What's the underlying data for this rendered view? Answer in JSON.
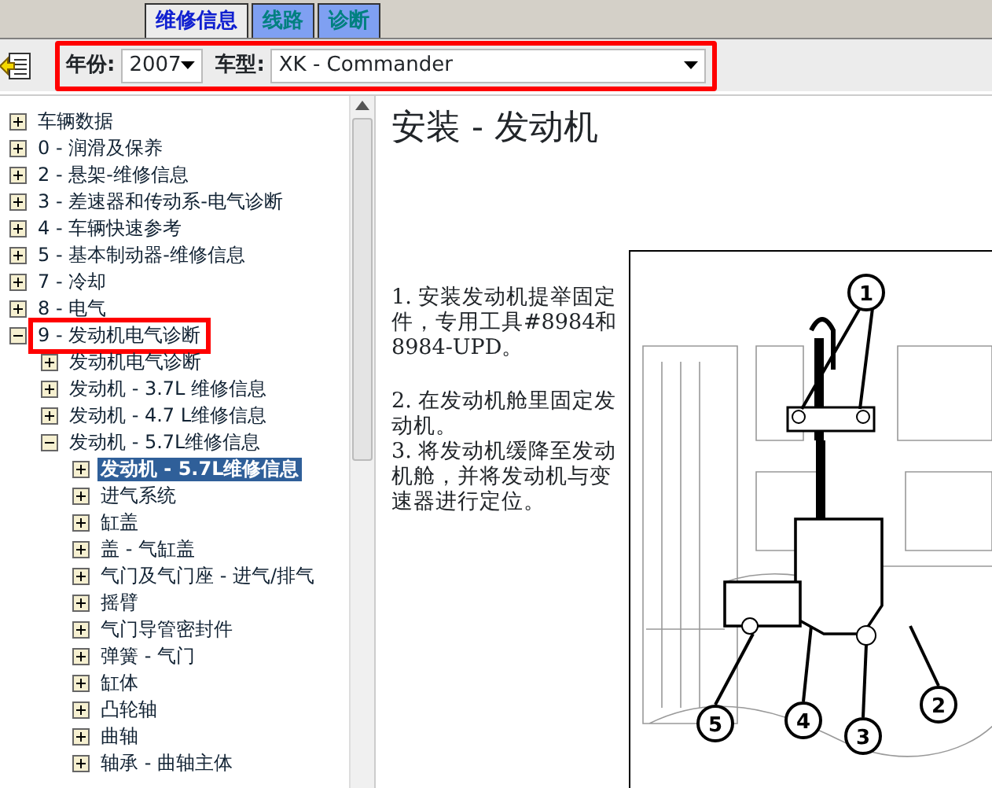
{
  "tabs": [
    {
      "label": "维修信息",
      "selected": true
    },
    {
      "label": "线路",
      "selected": false
    },
    {
      "label": "诊断",
      "selected": false
    }
  ],
  "toolbar": {
    "highlighted": true,
    "year": {
      "label": "年份:",
      "value": "2007"
    },
    "model": {
      "label": "车型:",
      "value": "XK - Commander"
    }
  },
  "tree": [
    {
      "label": "车辆数据",
      "expanded": false,
      "selected": false,
      "highlighted": false
    },
    {
      "label": "0 - 润滑及保养",
      "expanded": false,
      "selected": false,
      "highlighted": false
    },
    {
      "label": "2 - 悬架-维修信息",
      "expanded": false,
      "selected": false,
      "highlighted": false
    },
    {
      "label": "3 - 差速器和传动系-电气诊断",
      "expanded": false,
      "selected": false,
      "highlighted": false
    },
    {
      "label": "4 - 车辆快速参考",
      "expanded": false,
      "selected": false,
      "highlighted": false
    },
    {
      "label": "5 - 基本制动器-维修信息",
      "expanded": false,
      "selected": false,
      "highlighted": false
    },
    {
      "label": "7 - 冷却",
      "expanded": false,
      "selected": false,
      "highlighted": false
    },
    {
      "label": "8 - 电气",
      "expanded": false,
      "selected": false,
      "highlighted": false
    },
    {
      "label": "9 - 发动机电气诊断",
      "expanded": true,
      "selected": false,
      "highlighted": true,
      "children": [
        {
          "label": "发动机电气诊断",
          "expanded": false,
          "selected": false,
          "highlighted": false
        },
        {
          "label": "发动机  - 3.7L 维修信息",
          "expanded": false,
          "selected": false,
          "highlighted": false
        },
        {
          "label": "发动机  - 4.7 L维修信息",
          "expanded": false,
          "selected": false,
          "highlighted": false
        },
        {
          "label": "发动机  - 5.7L维修信息",
          "expanded": true,
          "selected": false,
          "highlighted": false,
          "children": [
            {
              "label": "发动机  - 5.7L维修信息",
              "expanded": false,
              "selected": true,
              "highlighted": false
            },
            {
              "label": "进气系统",
              "expanded": false,
              "selected": false,
              "highlighted": false
            },
            {
              "label": "缸盖",
              "expanded": false,
              "selected": false,
              "highlighted": false
            },
            {
              "label": "盖  - 气缸盖",
              "expanded": false,
              "selected": false,
              "highlighted": false
            },
            {
              "label": "气门及气门座  - 进气/排气",
              "expanded": false,
              "selected": false,
              "highlighted": false
            },
            {
              "label": "摇臂",
              "expanded": false,
              "selected": false,
              "highlighted": false
            },
            {
              "label": "气门导管密封件",
              "expanded": false,
              "selected": false,
              "highlighted": false
            },
            {
              "label": "弹簧  - 气门",
              "expanded": false,
              "selected": false,
              "highlighted": false
            },
            {
              "label": "缸体",
              "expanded": false,
              "selected": false,
              "highlighted": false
            },
            {
              "label": "凸轮轴",
              "expanded": false,
              "selected": false,
              "highlighted": false
            },
            {
              "label": "曲轴",
              "expanded": false,
              "selected": false,
              "highlighted": false
            },
            {
              "label": "轴承  - 曲轴主体",
              "expanded": false,
              "selected": false,
              "highlighted": false
            }
          ]
        }
      ]
    }
  ],
  "article": {
    "title": "安装  - 发动机",
    "steps": [
      "1. 安装发动机提举固定件，专用工具#8984和8984-UPD。",
      "2. 在发动机舱里固定发动机。",
      "3. 将发动机缓降至发动机舱，并将发动机与变速器进行定位。"
    ],
    "figure": {
      "callouts": [
        "1",
        "2",
        "3",
        "4",
        "5"
      ]
    }
  }
}
